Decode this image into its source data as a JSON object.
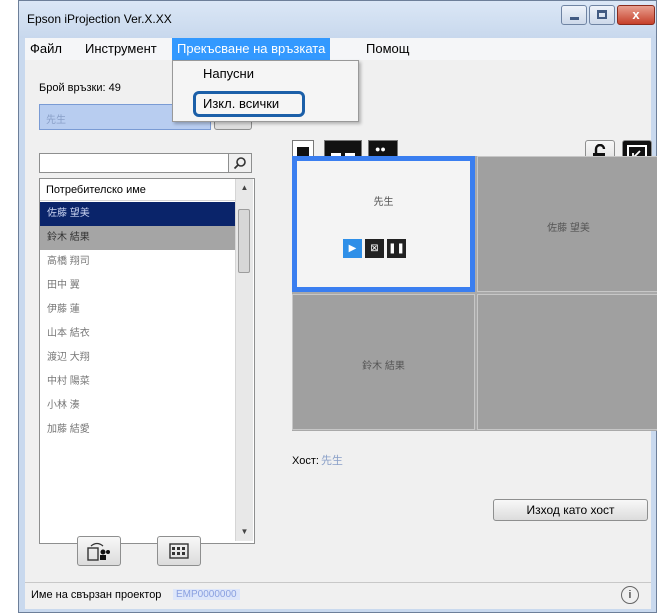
{
  "window": {
    "title": "Epson iProjection Ver.X.XX",
    "close_glyph": "x"
  },
  "menu": {
    "items": [
      "Файл",
      "Инструмент",
      "Прекъсване на връзката",
      "Помощ"
    ],
    "active_index": 2,
    "dropdown": [
      "Напусни",
      "Изкл. всички"
    ]
  },
  "connections": {
    "label": "Брой връзки: 49"
  },
  "search": {
    "value": "",
    "placeholder": ""
  },
  "users": {
    "header": "Потребителско име",
    "rows": [
      "佐藤 望美",
      "鈴木 結果",
      "高橋 翔司",
      "田中 翼",
      "伊藤 蓮",
      "山本 結衣",
      "渡辺 大翔",
      "中村 陽菜",
      "小林 湊",
      "加藤 結愛"
    ],
    "selected_index": 0,
    "secondary_index": 1
  },
  "grid": {
    "cells": [
      "先生",
      "佐藤 望美",
      "",
      "鈴木 結果"
    ],
    "active_index": 0
  },
  "host": {
    "label": "Хост:",
    "name": "先生"
  },
  "buttons": {
    "exit_host": "Изход като хост"
  },
  "status": {
    "label": "Име на свързан проектор",
    "projector_name": "EMP0000000",
    "info_glyph": "i"
  },
  "accent_color": "#3a7ef0"
}
